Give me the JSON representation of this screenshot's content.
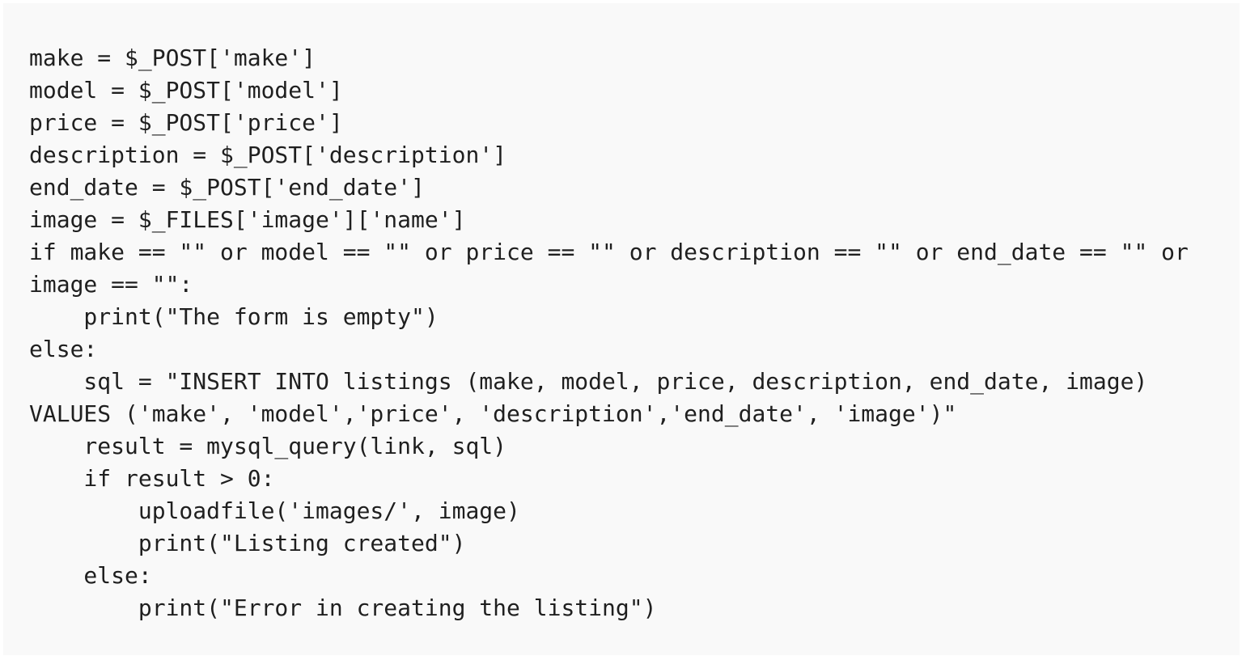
{
  "code_block": {
    "lines": [
      "make = $_POST['make']",
      "model = $_POST['model']",
      "price = $_POST['price']",
      "description = $_POST['description']",
      "end_date = $_POST['end_date']",
      "image = $_FILES['image']['name']",
      "if make == \"\" or model == \"\" or price == \"\" or description == \"\" or end_date == \"\" or",
      "image == \"\":",
      "    print(\"The form is empty\")",
      "else:",
      "    sql = \"INSERT INTO listings (make, model, price, description, end_date, image)",
      "VALUES ('make', 'model','price', 'description','end_date', 'image')\"",
      "    result = mysql_query(link, sql)",
      "    if result > 0:",
      "        uploadfile('images/', image)",
      "        print(\"Listing created\")",
      "    else:",
      "        print(\"Error in creating the listing\")"
    ]
  }
}
